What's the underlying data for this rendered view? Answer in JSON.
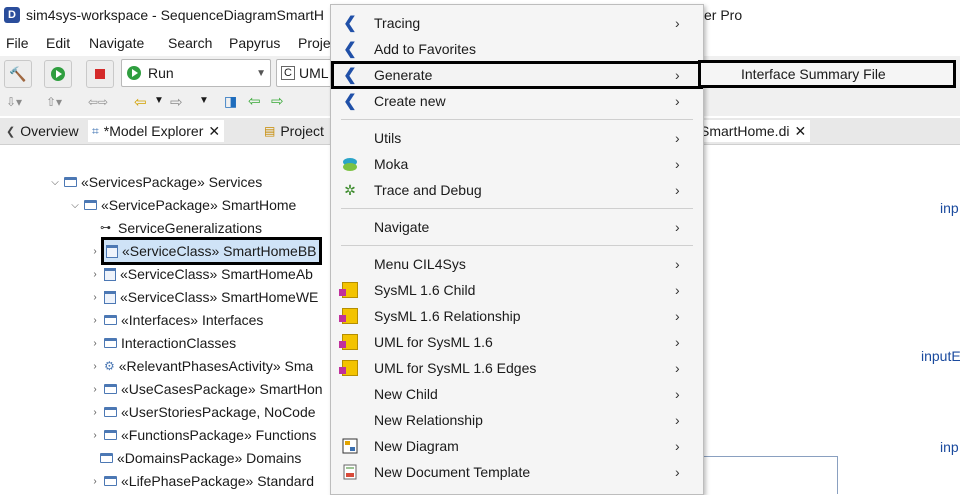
{
  "window": {
    "title": "sim4sys-workspace - SequenceDiagramSmartH",
    "title_right": "er Pro",
    "app_icon": "D"
  },
  "menubar": [
    "File",
    "Edit",
    "Navigate",
    "Search",
    "Papyrus",
    "Proje"
  ],
  "toolbar": {
    "run_label": "Run",
    "uml_label": "UML"
  },
  "tabs": {
    "overview": "Overview",
    "model_explorer": "*Model Explorer",
    "project": "Project",
    "diagram": "SmartHome.di"
  },
  "tree": [
    {
      "label": "«ServicesPackage» Services"
    },
    {
      "label": "«ServicePackage» SmartHome"
    },
    {
      "label": "ServiceGeneralizations"
    },
    {
      "label": "«ServiceClass» SmartHomeBB"
    },
    {
      "label": "«ServiceClass» SmartHomeAb"
    },
    {
      "label": "«ServiceClass» SmartHomeWE"
    },
    {
      "label": "«Interfaces» Interfaces"
    },
    {
      "label": "InteractionClasses"
    },
    {
      "label": "«RelevantPhasesActivity» Sma"
    },
    {
      "label": "«UseCasesPackage» SmartHon"
    },
    {
      "label": "«UserStoriesPackage, NoCode"
    },
    {
      "label": "«FunctionsPackage» Functions"
    },
    {
      "label": "«DomainsPackage» Domains"
    },
    {
      "label": "«LifePhasePackage» Standard"
    }
  ],
  "right_labels": [
    "inp",
    "inputE",
    "inp"
  ],
  "context_menu": [
    {
      "label": "Tracing",
      "icon": "chevron-icon"
    },
    {
      "label": "Add to Favorites",
      "icon": "chevron-icon"
    },
    {
      "label": "Generate",
      "icon": "chevron-icon"
    },
    {
      "label": "Create new",
      "icon": "chevron-icon"
    },
    {
      "label": "Utils",
      "icon": ""
    },
    {
      "label": "Moka",
      "icon": "moka-icon"
    },
    {
      "label": "Trace and Debug",
      "icon": "bug-icon"
    },
    {
      "label": "Navigate",
      "icon": ""
    },
    {
      "label": "Menu CIL4Sys",
      "icon": ""
    },
    {
      "label": "SysML 1.6 Child",
      "icon": "package-icon"
    },
    {
      "label": "SysML 1.6 Relationship",
      "icon": "package-icon"
    },
    {
      "label": "UML for SysML 1.6",
      "icon": "package-icon"
    },
    {
      "label": "UML for SysML 1.6 Edges",
      "icon": "package-icon"
    },
    {
      "label": "New Child",
      "icon": ""
    },
    {
      "label": "New Relationship",
      "icon": ""
    },
    {
      "label": "New Diagram",
      "icon": "diagram-icon"
    },
    {
      "label": "New Document Template",
      "icon": "document-icon"
    }
  ],
  "submenu": {
    "label": "Interface Summary File"
  },
  "submenu_arrow": "›"
}
